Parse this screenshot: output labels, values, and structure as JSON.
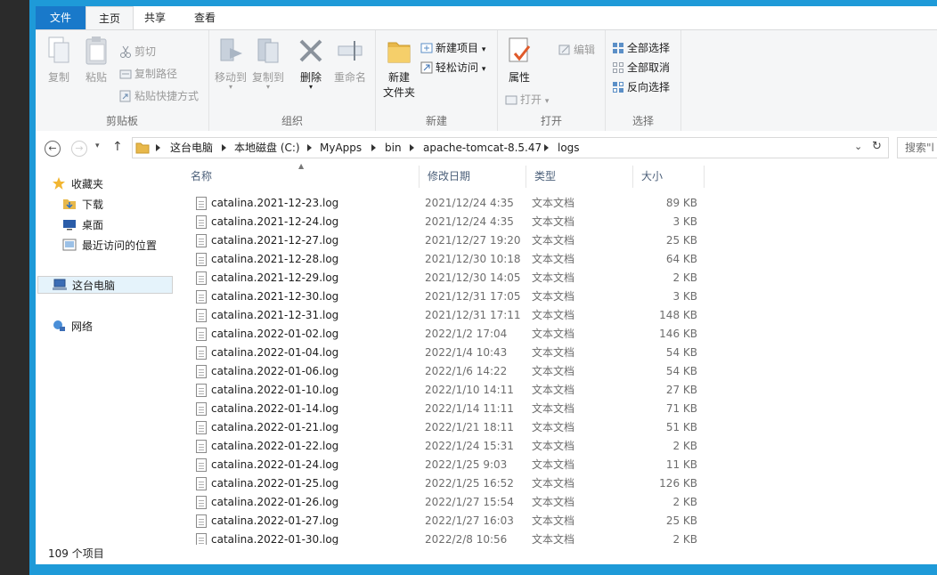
{
  "ribbon": {
    "tabs": [
      "文件",
      "主页",
      "共享",
      "查看"
    ],
    "clipboard": {
      "copy": "复制",
      "paste": "粘贴",
      "cut": "剪切",
      "copy_path": "复制路径",
      "paste_shortcut": "粘贴快捷方式",
      "label": "剪贴板"
    },
    "organize": {
      "move_to": "移动到",
      "copy_to": "复制到",
      "delete": "删除",
      "rename": "重命名",
      "label": "组织"
    },
    "new": {
      "new_folder_line1": "新建",
      "new_folder_line2": "文件夹",
      "new_item": "新建项目",
      "easy_access": "轻松访问",
      "label": "新建"
    },
    "open": {
      "properties": "属性",
      "open": "打开",
      "edit": "编辑",
      "label": "打开"
    },
    "select": {
      "select_all": "全部选择",
      "select_none": "全部取消",
      "invert": "反向选择",
      "label": "选择"
    }
  },
  "address": {
    "crumbs": [
      "这台电脑",
      "本地磁盘 (C:)",
      "MyApps",
      "bin",
      "apache-tomcat-8.5.47",
      "logs"
    ],
    "search_placeholder": "搜索\"l"
  },
  "nav": {
    "favorites": "收藏夹",
    "downloads": "下载",
    "desktop": "桌面",
    "recent": "最近访问的位置",
    "this_pc": "这台电脑",
    "network": "网络"
  },
  "columns": {
    "name": "名称",
    "date": "修改日期",
    "type": "类型",
    "size": "大小"
  },
  "files": [
    {
      "name": "catalina.2021-12-23.log",
      "date": "2021/12/24 4:35",
      "type": "文本文档",
      "size": "89 KB"
    },
    {
      "name": "catalina.2021-12-24.log",
      "date": "2021/12/24 4:35",
      "type": "文本文档",
      "size": "3 KB"
    },
    {
      "name": "catalina.2021-12-27.log",
      "date": "2021/12/27 19:20",
      "type": "文本文档",
      "size": "25 KB"
    },
    {
      "name": "catalina.2021-12-28.log",
      "date": "2021/12/30 10:18",
      "type": "文本文档",
      "size": "64 KB"
    },
    {
      "name": "catalina.2021-12-29.log",
      "date": "2021/12/30 14:05",
      "type": "文本文档",
      "size": "2 KB"
    },
    {
      "name": "catalina.2021-12-30.log",
      "date": "2021/12/31 17:05",
      "type": "文本文档",
      "size": "3 KB"
    },
    {
      "name": "catalina.2021-12-31.log",
      "date": "2021/12/31 17:11",
      "type": "文本文档",
      "size": "148 KB"
    },
    {
      "name": "catalina.2022-01-02.log",
      "date": "2022/1/2 17:04",
      "type": "文本文档",
      "size": "146 KB"
    },
    {
      "name": "catalina.2022-01-04.log",
      "date": "2022/1/4 10:43",
      "type": "文本文档",
      "size": "54 KB"
    },
    {
      "name": "catalina.2022-01-06.log",
      "date": "2022/1/6 14:22",
      "type": "文本文档",
      "size": "54 KB"
    },
    {
      "name": "catalina.2022-01-10.log",
      "date": "2022/1/10 14:11",
      "type": "文本文档",
      "size": "27 KB"
    },
    {
      "name": "catalina.2022-01-14.log",
      "date": "2022/1/14 11:11",
      "type": "文本文档",
      "size": "71 KB"
    },
    {
      "name": "catalina.2022-01-21.log",
      "date": "2022/1/21 18:11",
      "type": "文本文档",
      "size": "51 KB"
    },
    {
      "name": "catalina.2022-01-22.log",
      "date": "2022/1/24 15:31",
      "type": "文本文档",
      "size": "2 KB"
    },
    {
      "name": "catalina.2022-01-24.log",
      "date": "2022/1/25 9:03",
      "type": "文本文档",
      "size": "11 KB"
    },
    {
      "name": "catalina.2022-01-25.log",
      "date": "2022/1/25 16:52",
      "type": "文本文档",
      "size": "126 KB"
    },
    {
      "name": "catalina.2022-01-26.log",
      "date": "2022/1/27 15:54",
      "type": "文本文档",
      "size": "2 KB"
    },
    {
      "name": "catalina.2022-01-27.log",
      "date": "2022/1/27 16:03",
      "type": "文本文档",
      "size": "25 KB"
    },
    {
      "name": "catalina.2022-01-30.log",
      "date": "2022/2/8 10:56",
      "type": "文本文档",
      "size": "2 KB"
    }
  ],
  "status": {
    "count": "109 个项目"
  },
  "colors": {
    "accent": "#1e9ad8",
    "file_tab": "#1979ca"
  }
}
